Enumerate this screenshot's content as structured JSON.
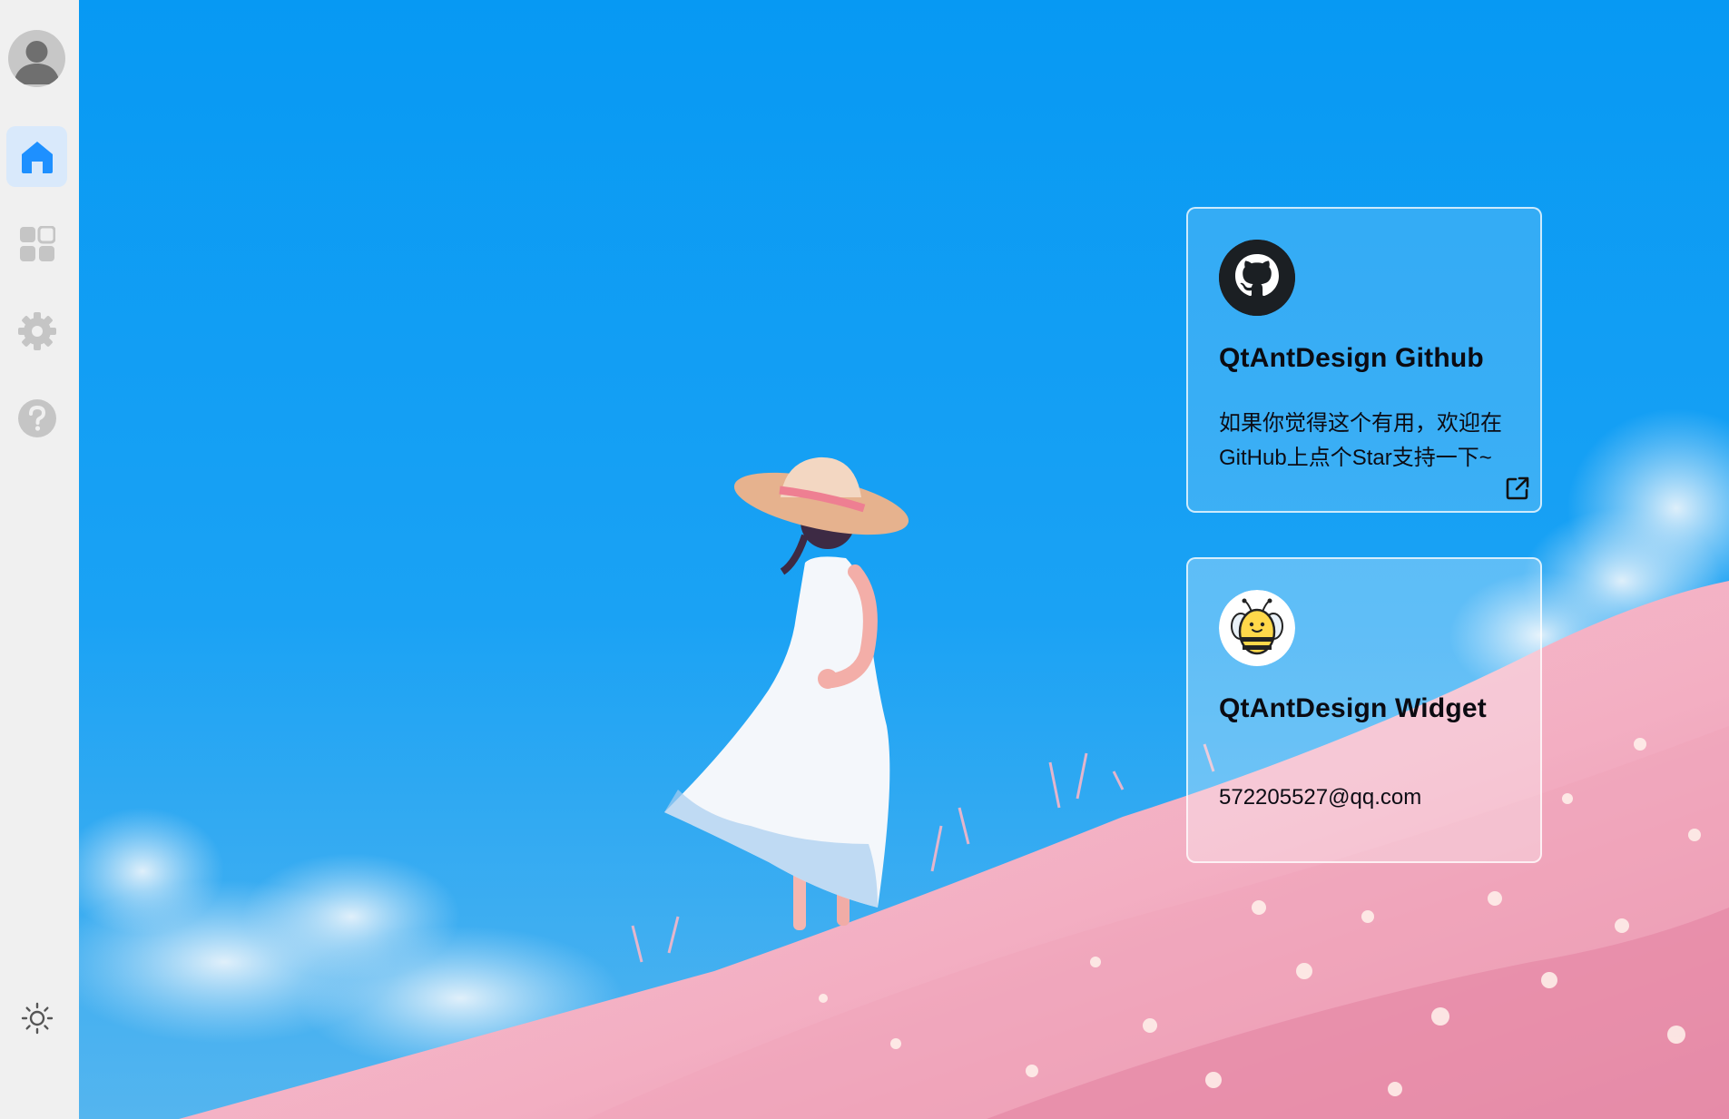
{
  "sidebar": {
    "items": [
      {
        "id": "home",
        "icon": "home-icon",
        "active": true
      },
      {
        "id": "apps",
        "icon": "apps-grid-icon",
        "active": false
      },
      {
        "id": "settings",
        "icon": "gear-icon",
        "active": false
      },
      {
        "id": "help",
        "icon": "question-icon",
        "active": false
      }
    ],
    "theme_toggle_icon": "sun-icon",
    "accent_color": "#1e90ff"
  },
  "cards": {
    "github": {
      "title": "QtAntDesign Github",
      "description": "如果你觉得这个有用，欢迎在GitHub上点个Star支持一下~",
      "icon": "github-logo-icon",
      "link_icon": "external-link-icon"
    },
    "widget": {
      "title": "QtAntDesign Widget",
      "email": "572205527@qq.com",
      "icon": "bee-logo-icon"
    }
  }
}
